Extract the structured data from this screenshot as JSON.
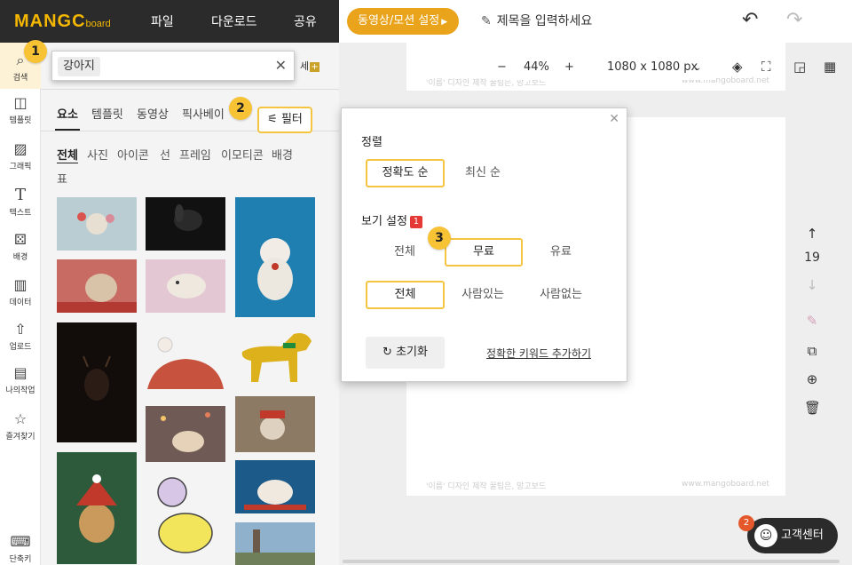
{
  "app": {
    "logo": "MANGC",
    "logo_sub": "board"
  },
  "topbar": {
    "menu": [
      "파일",
      "다운로드",
      "공유"
    ],
    "video_button": "동영상/모션 설정",
    "title_placeholder": "제목을 입력하세요"
  },
  "rail": [
    {
      "label": "검색",
      "icon": "search-icon"
    },
    {
      "label": "템플릿",
      "icon": "template-icon"
    },
    {
      "label": "그래픽",
      "icon": "graphic-icon"
    },
    {
      "label": "텍스트",
      "icon": "text-icon"
    },
    {
      "label": "배경",
      "icon": "background-icon"
    },
    {
      "label": "데이터",
      "icon": "chart-icon"
    },
    {
      "label": "업로드",
      "icon": "upload-icon"
    },
    {
      "label": "나의작업",
      "icon": "folder-icon"
    },
    {
      "label": "즐겨찾기",
      "icon": "star-icon"
    },
    {
      "label": "단축키",
      "icon": "keyboard-icon"
    }
  ],
  "search": {
    "query": "강아지",
    "detail_label": "세"
  },
  "tabs": [
    "요소",
    "템플릿",
    "동영상",
    "픽사베이"
  ],
  "filter_button": "필터",
  "categories": [
    "전체",
    "사진",
    "아이콘",
    "선",
    "프레임",
    "이모티콘",
    "배경",
    "표"
  ],
  "canvas": {
    "zoom": "44%",
    "size": "1080 x 1080 px",
    "page_number": "19",
    "footer_left": "'이름' 디자인 제작 꿀팁은, 망고보드",
    "footer_right": "www.mangoboard.net"
  },
  "popover": {
    "sort_title": "정렬",
    "sort_options": [
      "정확도 순",
      "최신 순"
    ],
    "view_title": "보기 설정",
    "view_badge": "1",
    "price_options": [
      "전체",
      "무료",
      "유료"
    ],
    "people_options": [
      "전체",
      "사람있는",
      "사람없는"
    ],
    "reset": "초기화",
    "keyword_link": "정확한 키워드 추가하기"
  },
  "steps": [
    "1",
    "2",
    "3"
  ],
  "help": {
    "label": "고객센터",
    "badge": "2"
  },
  "colors": {
    "accent": "#f5c542",
    "brand": "#e9a41c",
    "dark": "#2b2b2b"
  }
}
